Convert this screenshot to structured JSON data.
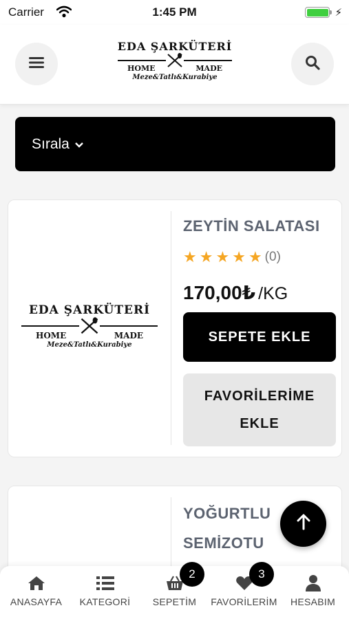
{
  "status_bar": {
    "carrier": "Carrier",
    "time": "1:45 PM"
  },
  "logo": {
    "brand": "EDA ŞARKÜTERİ",
    "left": "HOME",
    "right": "MADE",
    "tagline": "Meze&Tatlı&Kurabiye"
  },
  "sort": {
    "label": "Sırala"
  },
  "products": [
    {
      "name": "ZEYTİN SALATASI",
      "rating_count": "(0)",
      "price": "170,00₺",
      "unit": "/KG",
      "cart_label": "SEPETE EKLE",
      "fav_label": "FAVORİLERİME EKLE"
    },
    {
      "name_line1": "YOĞURTLU",
      "name_line2": "SEMİZOTU"
    }
  ],
  "tabs": [
    {
      "label": "ANASAYFA"
    },
    {
      "label": "KATEGORİ"
    },
    {
      "label": "SEPETİM",
      "badge": "2"
    },
    {
      "label": "FAVORİLERİM",
      "badge": "3"
    },
    {
      "label": "HESABIM"
    }
  ],
  "colors": {
    "star": "#f5a623",
    "primary": "#000000",
    "title_gray": "#5c6370",
    "battery": "#3fcf3f"
  },
  "icons": [
    "menu-icon",
    "search-icon",
    "chevron-down-icon",
    "arrow-up-icon",
    "home-icon",
    "list-icon",
    "basket-icon",
    "heart-icon",
    "user-icon"
  ]
}
